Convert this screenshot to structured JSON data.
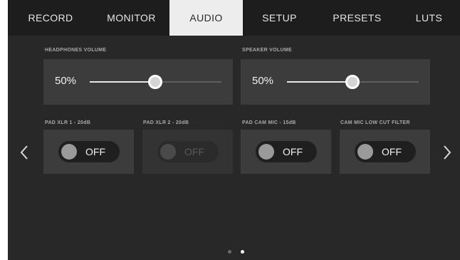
{
  "tabs": [
    {
      "label": "RECORD",
      "active": false
    },
    {
      "label": "MONITOR",
      "active": false
    },
    {
      "label": "AUDIO",
      "active": true
    },
    {
      "label": "SETUP",
      "active": false
    },
    {
      "label": "PRESETS",
      "active": false
    },
    {
      "label": "LUTS",
      "active": false
    }
  ],
  "volume": {
    "headphones": {
      "label": "HEADPHONES VOLUME",
      "value": "50%",
      "level": 0.5
    },
    "speaker": {
      "label": "SPEAKER VOLUME",
      "value": "50%",
      "level": 0.5
    }
  },
  "toggles": [
    {
      "label": "PAD XLR 1 - 20dB",
      "state": "OFF",
      "enabled": true
    },
    {
      "label": "PAD XLR 2 - 20dB",
      "state": "OFF",
      "enabled": false
    },
    {
      "label": "PAD CAM MIC - 15dB",
      "state": "OFF",
      "enabled": true
    },
    {
      "label": "CAM MIC LOW CUT FILTER",
      "state": "OFF",
      "enabled": true
    }
  ],
  "navigation": {
    "prev_icon": "chevron-left-icon",
    "next_icon": "chevron-right-icon"
  },
  "pagination": {
    "pages": 2,
    "current": 2
  },
  "colors": {
    "background": "#282828",
    "tabbar": "#1d1d1d",
    "active_tab": "#ededed",
    "panel": "#3c3c3c"
  }
}
